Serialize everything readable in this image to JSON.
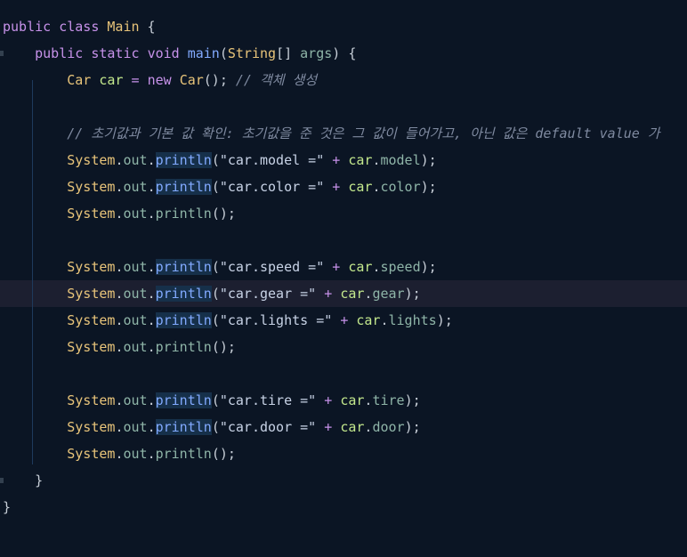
{
  "editor": {
    "lines": [
      {
        "id": "l1",
        "tokens": [
          [
            "kw",
            "public"
          ],
          [
            "punc",
            " "
          ],
          [
            "kw",
            "class"
          ],
          [
            "punc",
            " "
          ],
          [
            "ty",
            "Main"
          ],
          [
            "punc",
            " {"
          ]
        ]
      },
      {
        "id": "l2",
        "tokens": [
          [
            "punc",
            "    "
          ],
          [
            "kw",
            "public"
          ],
          [
            "punc",
            " "
          ],
          [
            "kw",
            "static"
          ],
          [
            "punc",
            " "
          ],
          [
            "kw",
            "void"
          ],
          [
            "punc",
            " "
          ],
          [
            "fn",
            "main"
          ],
          [
            "punc",
            "("
          ],
          [
            "ty",
            "String"
          ],
          [
            "punc",
            "[] "
          ],
          [
            "prop",
            "args"
          ],
          [
            "punc",
            ") {"
          ]
        ]
      },
      {
        "id": "l3",
        "tokens": [
          [
            "punc",
            "        "
          ],
          [
            "ty",
            "Car"
          ],
          [
            "punc",
            " "
          ],
          [
            "var",
            "car"
          ],
          [
            "punc",
            " "
          ],
          [
            "op",
            "="
          ],
          [
            "punc",
            " "
          ],
          [
            "kw",
            "new"
          ],
          [
            "punc",
            " "
          ],
          [
            "ty",
            "Car"
          ],
          [
            "punc",
            "(); "
          ],
          [
            "cm",
            "// 객체 생성"
          ]
        ]
      },
      {
        "id": "l4",
        "tokens": []
      },
      {
        "id": "l5",
        "tokens": [
          [
            "punc",
            "        "
          ],
          [
            "cm",
            "// 초기값과 기본 값 확인: 초기값을 준 것은 그 값이 들어가고, 아닌 값은 default value 가"
          ]
        ]
      },
      {
        "id": "l6",
        "tokens": [
          [
            "punc",
            "        "
          ],
          [
            "ty",
            "System"
          ],
          [
            "punc",
            "."
          ],
          [
            "prop",
            "out"
          ],
          [
            "punc",
            "."
          ],
          [
            "fnh",
            "println"
          ],
          [
            "punc",
            "("
          ],
          [
            "str",
            "\"car.model =\""
          ],
          [
            "punc",
            " "
          ],
          [
            "op",
            "+"
          ],
          [
            "punc",
            " "
          ],
          [
            "var",
            "car"
          ],
          [
            "punc",
            "."
          ],
          [
            "prop",
            "model"
          ],
          [
            "punc",
            ");"
          ]
        ]
      },
      {
        "id": "l7",
        "tokens": [
          [
            "punc",
            "        "
          ],
          [
            "ty",
            "System"
          ],
          [
            "punc",
            "."
          ],
          [
            "prop",
            "out"
          ],
          [
            "punc",
            "."
          ],
          [
            "fnh",
            "println"
          ],
          [
            "punc",
            "("
          ],
          [
            "str",
            "\"car.color =\""
          ],
          [
            "punc",
            " "
          ],
          [
            "op",
            "+"
          ],
          [
            "punc",
            " "
          ],
          [
            "var",
            "car"
          ],
          [
            "punc",
            "."
          ],
          [
            "prop",
            "color"
          ],
          [
            "punc",
            ");"
          ]
        ]
      },
      {
        "id": "l8",
        "tokens": [
          [
            "punc",
            "        "
          ],
          [
            "ty",
            "System"
          ],
          [
            "punc",
            "."
          ],
          [
            "prop",
            "out"
          ],
          [
            "punc",
            "."
          ],
          [
            "prop",
            "println"
          ],
          [
            "punc",
            "();"
          ]
        ]
      },
      {
        "id": "l9",
        "tokens": []
      },
      {
        "id": "l10",
        "tokens": [
          [
            "punc",
            "        "
          ],
          [
            "ty",
            "System"
          ],
          [
            "punc",
            "."
          ],
          [
            "prop",
            "out"
          ],
          [
            "punc",
            "."
          ],
          [
            "fnh",
            "println"
          ],
          [
            "punc",
            "("
          ],
          [
            "str",
            "\"car.speed =\""
          ],
          [
            "punc",
            " "
          ],
          [
            "op",
            "+"
          ],
          [
            "punc",
            " "
          ],
          [
            "var",
            "car"
          ],
          [
            "punc",
            "."
          ],
          [
            "prop",
            "speed"
          ],
          [
            "punc",
            ");"
          ]
        ]
      },
      {
        "id": "l11",
        "current": true,
        "tokens": [
          [
            "punc",
            "        "
          ],
          [
            "ty",
            "System"
          ],
          [
            "punc",
            "."
          ],
          [
            "prop",
            "out"
          ],
          [
            "punc",
            "."
          ],
          [
            "fnh",
            "println"
          ],
          [
            "punc",
            "("
          ],
          [
            "str",
            "\"car.gear =\""
          ],
          [
            "punc",
            " "
          ],
          [
            "op",
            "+"
          ],
          [
            "punc",
            " "
          ],
          [
            "var",
            "car"
          ],
          [
            "punc",
            "."
          ],
          [
            "prop",
            "gear"
          ],
          [
            "punc",
            ");"
          ]
        ]
      },
      {
        "id": "l12",
        "tokens": [
          [
            "punc",
            "        "
          ],
          [
            "ty",
            "System"
          ],
          [
            "punc",
            "."
          ],
          [
            "prop",
            "out"
          ],
          [
            "punc",
            "."
          ],
          [
            "fnh",
            "println"
          ],
          [
            "punc",
            "("
          ],
          [
            "str",
            "\"car.lights =\""
          ],
          [
            "punc",
            " "
          ],
          [
            "op",
            "+"
          ],
          [
            "punc",
            " "
          ],
          [
            "var",
            "car"
          ],
          [
            "punc",
            "."
          ],
          [
            "prop",
            "lights"
          ],
          [
            "punc",
            ");"
          ]
        ]
      },
      {
        "id": "l13",
        "tokens": [
          [
            "punc",
            "        "
          ],
          [
            "ty",
            "System"
          ],
          [
            "punc",
            "."
          ],
          [
            "prop",
            "out"
          ],
          [
            "punc",
            "."
          ],
          [
            "prop",
            "println"
          ],
          [
            "punc",
            "();"
          ]
        ]
      },
      {
        "id": "l14",
        "tokens": []
      },
      {
        "id": "l15",
        "tokens": [
          [
            "punc",
            "        "
          ],
          [
            "ty",
            "System"
          ],
          [
            "punc",
            "."
          ],
          [
            "prop",
            "out"
          ],
          [
            "punc",
            "."
          ],
          [
            "fnh",
            "println"
          ],
          [
            "punc",
            "("
          ],
          [
            "str",
            "\"car.tire =\""
          ],
          [
            "punc",
            " "
          ],
          [
            "op",
            "+"
          ],
          [
            "punc",
            " "
          ],
          [
            "var",
            "car"
          ],
          [
            "punc",
            "."
          ],
          [
            "prop",
            "tire"
          ],
          [
            "punc",
            ");"
          ]
        ]
      },
      {
        "id": "l16",
        "tokens": [
          [
            "punc",
            "        "
          ],
          [
            "ty",
            "System"
          ],
          [
            "punc",
            "."
          ],
          [
            "prop",
            "out"
          ],
          [
            "punc",
            "."
          ],
          [
            "fnh",
            "println"
          ],
          [
            "punc",
            "("
          ],
          [
            "str",
            "\"car.door =\""
          ],
          [
            "punc",
            " "
          ],
          [
            "op",
            "+"
          ],
          [
            "punc",
            " "
          ],
          [
            "var",
            "car"
          ],
          [
            "punc",
            "."
          ],
          [
            "prop",
            "door"
          ],
          [
            "punc",
            ");"
          ]
        ]
      },
      {
        "id": "l17",
        "tokens": [
          [
            "punc",
            "        "
          ],
          [
            "ty",
            "System"
          ],
          [
            "punc",
            "."
          ],
          [
            "prop",
            "out"
          ],
          [
            "punc",
            "."
          ],
          [
            "prop",
            "println"
          ],
          [
            "punc",
            "();"
          ]
        ]
      },
      {
        "id": "l18",
        "tokens": [
          [
            "punc",
            "    }"
          ]
        ]
      },
      {
        "id": "l19",
        "tokens": [
          [
            "punc",
            "}"
          ]
        ]
      }
    ]
  },
  "colors": {
    "background": "#0b1524",
    "current_line": "#1c1f30",
    "keyword": "#c792ea",
    "type": "#e8c47a",
    "function": "#82aaff",
    "property": "#8fb5a8",
    "variable": "#c3e88d",
    "comment": "#7f8aa0"
  }
}
